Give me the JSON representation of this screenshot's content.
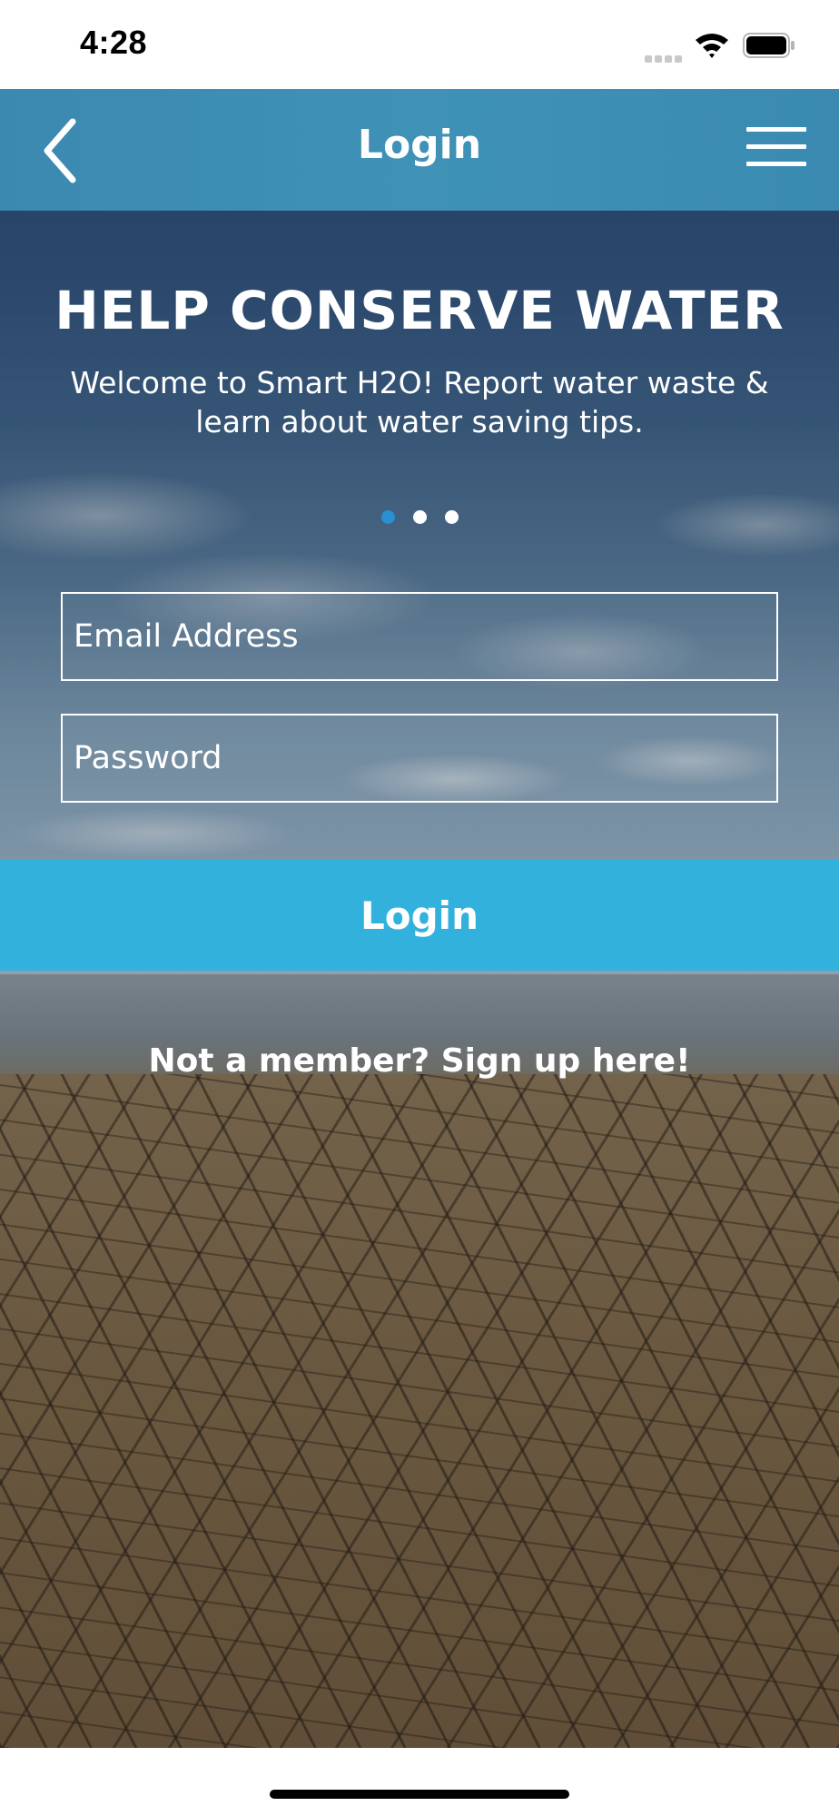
{
  "status_bar": {
    "time": "4:28",
    "icons": [
      "cellular-signal-icon",
      "wifi-icon",
      "battery-icon"
    ]
  },
  "nav": {
    "title": "Login",
    "back_icon": "chevron-left-icon",
    "menu_icon": "hamburger-menu-icon"
  },
  "hero": {
    "title": "HELP CONSERVE WATER",
    "subtitle": "Welcome to Smart H2O! Report water waste & learn about water saving tips.",
    "pages": {
      "count": 3,
      "active_index": 0
    }
  },
  "form": {
    "email_placeholder": "Email Address",
    "email_value": "",
    "password_placeholder": "Password",
    "password_value": ""
  },
  "login_button": "Login",
  "signup_link": "Not a member? Sign up here!",
  "colors": {
    "nav_bar": "#3f92b6",
    "login_button": "#33b1dd",
    "active_dot": "#2a8fd0",
    "text": "#ffffff"
  }
}
